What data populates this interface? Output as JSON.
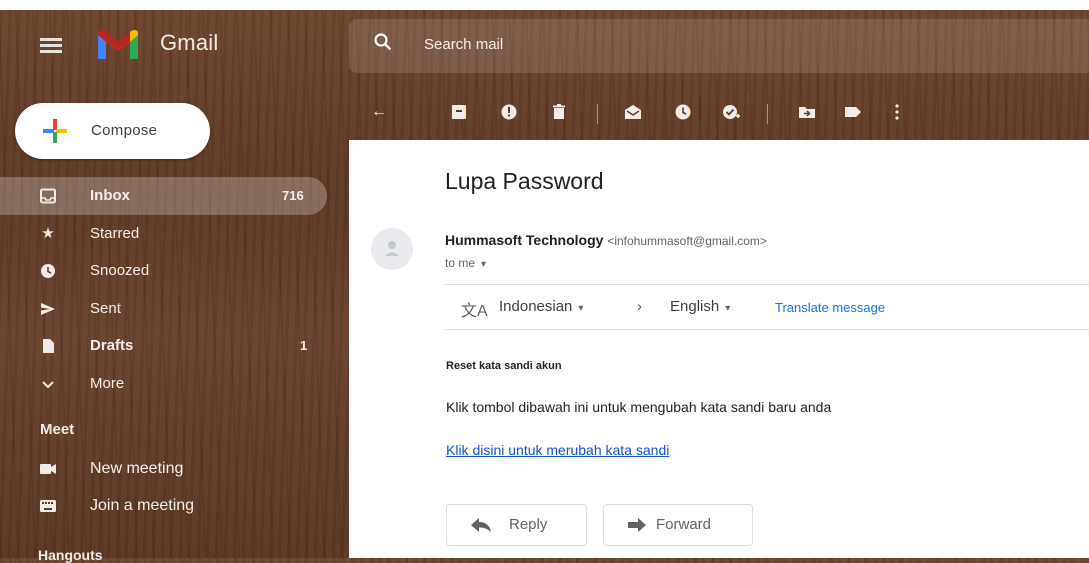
{
  "app": {
    "name": "Gmail"
  },
  "search": {
    "placeholder": "Search mail"
  },
  "compose": {
    "label": "Compose"
  },
  "nav": [
    {
      "label": "Inbox",
      "count": "716",
      "icon": "inbox-icon",
      "active": true,
      "bold": true
    },
    {
      "label": "Starred",
      "count": "",
      "icon": "star-icon",
      "active": false,
      "bold": false
    },
    {
      "label": "Snoozed",
      "count": "",
      "icon": "clock-icon",
      "active": false,
      "bold": false
    },
    {
      "label": "Sent",
      "count": "",
      "icon": "send-icon",
      "active": false,
      "bold": false
    },
    {
      "label": "Drafts",
      "count": "1",
      "icon": "draft-icon",
      "active": false,
      "bold": true
    },
    {
      "label": "More",
      "count": "",
      "icon": "chevron-down-icon",
      "active": false,
      "bold": false
    }
  ],
  "meet": {
    "title": "Meet",
    "items": [
      {
        "label": "New meeting",
        "icon": "video-icon"
      },
      {
        "label": "Join a meeting",
        "icon": "keyboard-icon"
      }
    ]
  },
  "hangouts": {
    "title": "Hangouts"
  },
  "toolbar": {
    "icons": [
      "back-arrow-icon",
      "archive-icon",
      "report-spam-icon",
      "delete-icon",
      "mark-unread-icon",
      "snooze-icon",
      "add-to-tasks-icon",
      "move-to-icon",
      "labels-icon",
      "more-vert-icon"
    ]
  },
  "message": {
    "subject": "Lupa Password",
    "sender_name": "Hummasoft Technology",
    "sender_email": "<infohummasoft@gmail.com>",
    "to": "to me",
    "translate": {
      "from": "Indonesian",
      "to": "English",
      "link": "Translate message"
    },
    "heading": "Reset kata sandi akun",
    "text": "Klik tombol dibawah ini untuk mengubah kata sandi baru anda",
    "link": "Klik disini untuk merubah kata sandi"
  },
  "actions": {
    "reply": "Reply",
    "forward": "Forward"
  },
  "colors": {
    "link": "#1155cc",
    "translate_link": "#1a73e8",
    "logo_red": "#ea4335",
    "logo_blue": "#4285f4",
    "logo_green": "#34a853",
    "logo_yellow": "#fbbc04"
  }
}
